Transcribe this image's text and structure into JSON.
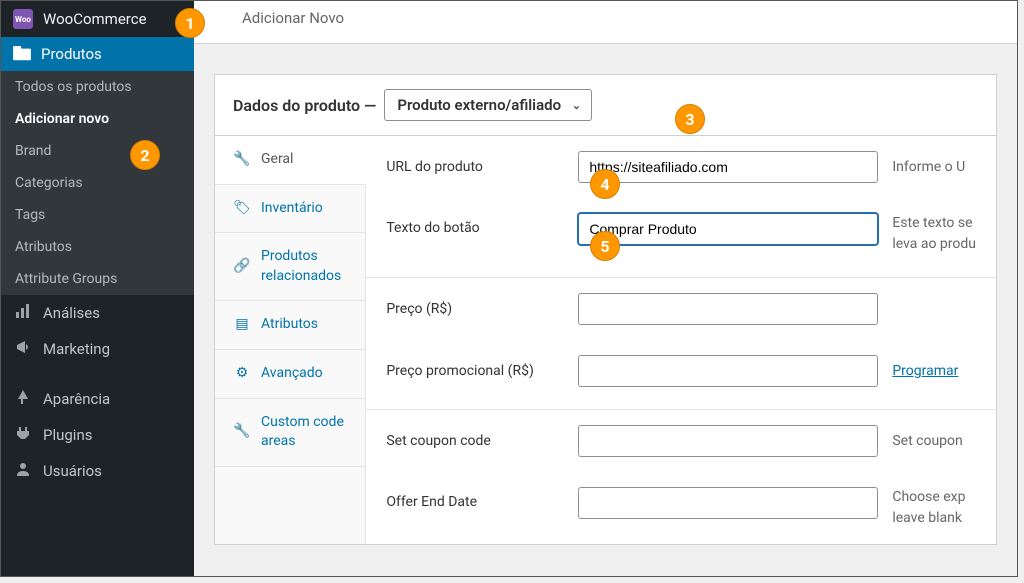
{
  "sidebar": {
    "woocommerce": "WooCommerce",
    "products_menu": "Produtos",
    "submenu": {
      "all_products": "Todos os produtos",
      "add_new": "Adicionar novo",
      "brand": "Brand",
      "categories": "Categorias",
      "tags": "Tags",
      "attributes": "Atributos",
      "attribute_groups": "Attribute Groups"
    },
    "items": {
      "analytics": "Análises",
      "marketing": "Marketing",
      "appearance": "Aparência",
      "plugins": "Plugins",
      "users": "Usuários"
    }
  },
  "header": {
    "add_new": "Adicionar Novo"
  },
  "panel": {
    "title": "Dados do produto —",
    "product_type": "Produto externo/afiliado"
  },
  "tabs": {
    "general": "Geral",
    "inventory": "Inventário",
    "linked": "Produtos relacionados",
    "attributes": "Atributos",
    "advanced": "Avançado",
    "custom": "Custom code areas"
  },
  "form": {
    "url_label": "URL do produto",
    "url_value": "https://siteafiliado.com",
    "url_hint": "Informe o U",
    "button_text_label": "Texto do botão",
    "button_text_value": "Comprar Produto",
    "button_text_hint_1": "Este texto se",
    "button_text_hint_2": "leva ao produ",
    "price_label": "Preço (R$)",
    "sale_price_label": "Preço promocional (R$)",
    "schedule_link": "Programar",
    "coupon_label": "Set coupon code",
    "coupon_hint": "Set coupon",
    "offer_end_label": "Offer End Date",
    "offer_end_hint_1": "Choose exp",
    "offer_end_hint_2": "leave blank"
  },
  "badges": {
    "b1": "1",
    "b2": "2",
    "b3": "3",
    "b4": "4",
    "b5": "5"
  }
}
